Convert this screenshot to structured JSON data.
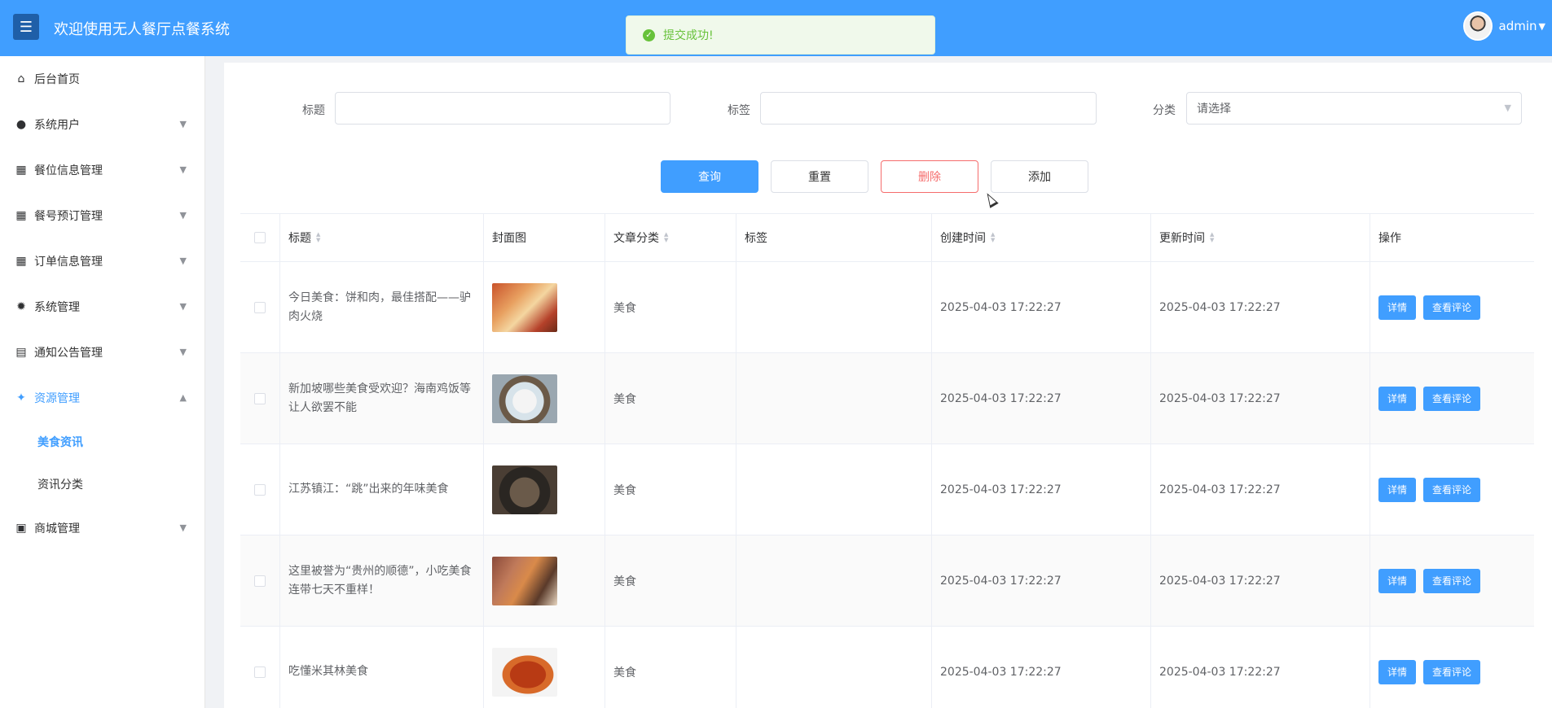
{
  "header": {
    "title": "欢迎使用无人餐厅点餐系统",
    "username": "admin"
  },
  "toast": {
    "message": "提交成功!"
  },
  "sidebar": {
    "items": [
      {
        "label": "后台首页",
        "icon": "home-icon",
        "expandable": false
      },
      {
        "label": "系统用户",
        "icon": "user-icon",
        "expandable": true
      },
      {
        "label": "餐位信息管理",
        "icon": "grid-icon",
        "expandable": true
      },
      {
        "label": "餐号预订管理",
        "icon": "grid-icon",
        "expandable": true
      },
      {
        "label": "订单信息管理",
        "icon": "grid-icon",
        "expandable": true
      },
      {
        "label": "系统管理",
        "icon": "gear-icon",
        "expandable": true
      },
      {
        "label": "通知公告管理",
        "icon": "document-icon",
        "expandable": true
      },
      {
        "label": "资源管理",
        "icon": "compass-icon",
        "expandable": true,
        "expanded": true,
        "children": [
          {
            "label": "美食资讯",
            "active": true
          },
          {
            "label": "资讯分类"
          }
        ]
      },
      {
        "label": "商城管理",
        "icon": "bag-icon",
        "expandable": true
      }
    ]
  },
  "search": {
    "title_label": "标题",
    "title_value": "",
    "tag_label": "标签",
    "tag_value": "",
    "category_label": "分类",
    "category_placeholder": "请选择"
  },
  "buttons": {
    "query": "查询",
    "reset": "重置",
    "delete": "删除",
    "add": "添加"
  },
  "table": {
    "columns": [
      "标题",
      "封面图",
      "文章分类",
      "标签",
      "创建时间",
      "更新时间",
      "操作"
    ],
    "rows": [
      {
        "title": "今日美食：饼和肉，最佳搭配——驴肉火烧",
        "category": "美食",
        "tags": "",
        "created": "2025-04-03 17:22:27",
        "updated": "2025-04-03 17:22:27"
      },
      {
        "title": "新加坡哪些美食受欢迎？海南鸡饭等让人欲罢不能",
        "category": "美食",
        "tags": "",
        "created": "2025-04-03 17:22:27",
        "updated": "2025-04-03 17:22:27"
      },
      {
        "title": "江苏镇江：“跳”出来的年味美食",
        "category": "美食",
        "tags": "",
        "created": "2025-04-03 17:22:27",
        "updated": "2025-04-03 17:22:27"
      },
      {
        "title": "这里被誉为“贵州的顺德”，小吃美食连带七天不重样！",
        "category": "美食",
        "tags": "",
        "created": "2025-04-03 17:22:27",
        "updated": "2025-04-03 17:22:27"
      },
      {
        "title": "吃懂米其林美食",
        "category": "美食",
        "tags": "",
        "created": "2025-04-03 17:22:27",
        "updated": "2025-04-03 17:22:27"
      }
    ],
    "row_actions": {
      "detail": "详情",
      "comments": "查看评论"
    }
  }
}
